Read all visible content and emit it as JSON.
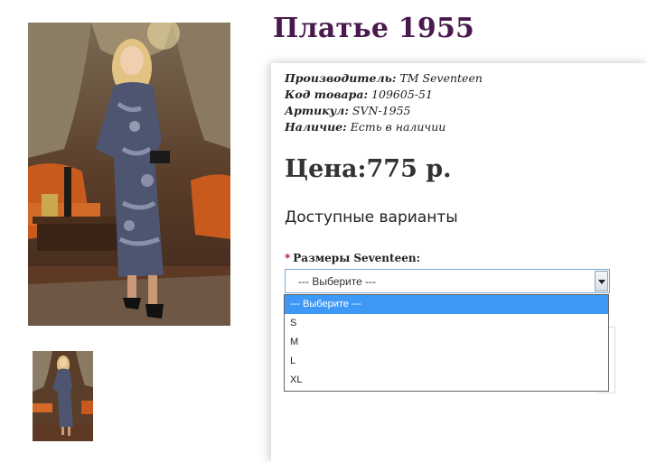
{
  "product": {
    "title": "Платье 1955",
    "price": "Цена:775 р."
  },
  "info": [
    {
      "key": "Производитель:",
      "value": " TM Seventeen"
    },
    {
      "key": "Код товара:",
      "value": " 109605-51"
    },
    {
      "key": "Артикул:",
      "value": " SVN-1955"
    },
    {
      "key": "Наличие:",
      "value": " Есть в наличии"
    }
  ],
  "variants": {
    "heading": "Доступные варианты",
    "required_mark": "*",
    "size_label": "Размеры Seventeen:",
    "selected": "--- Выберите ---",
    "options": [
      "--- Выберите ---",
      "S",
      "M",
      "L",
      "XL"
    ]
  },
  "colors": {
    "title": "#4a1a4e",
    "selected_option": "#3d99f5",
    "required": "#cc0000"
  }
}
